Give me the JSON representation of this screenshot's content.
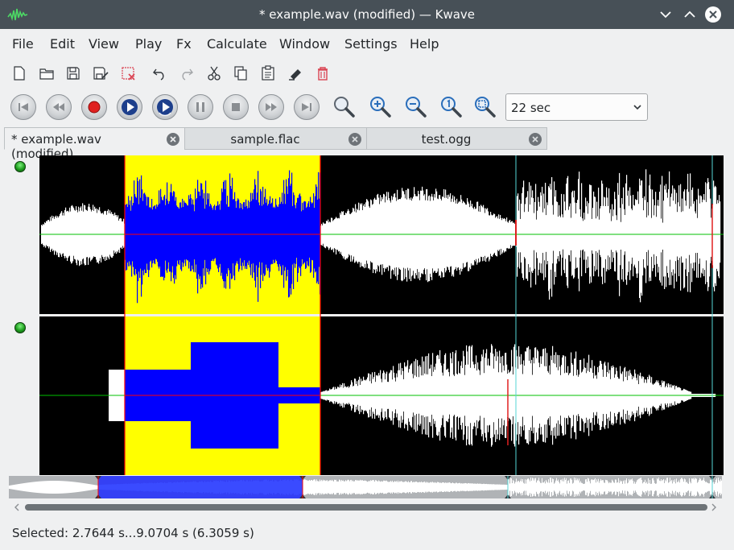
{
  "window": {
    "title": "* example.wav (modified) — Kwave"
  },
  "menu": [
    "File",
    "Edit",
    "View",
    "Play",
    "Fx",
    "Calculate",
    "Window",
    "Settings",
    "Help"
  ],
  "toolbar": {
    "file_icons": [
      "new-file-icon",
      "open-folder-icon",
      "save-icon",
      "save-as-icon",
      "close-file-icon"
    ],
    "edit_icons": [
      "undo-icon",
      "redo-icon",
      "cut-icon",
      "copy-icon",
      "paste-icon",
      "erase-icon",
      "delete-icon"
    ]
  },
  "transport": [
    "rewind-to-start-icon",
    "rewind-icon",
    "record-icon",
    "play-icon",
    "loop-play-icon",
    "pause-icon",
    "stop-icon",
    "forward-icon",
    "forward-to-end-icon"
  ],
  "zoom": {
    "icons": [
      "zoom-selection-icon",
      "zoom-in-icon",
      "zoom-out-icon",
      "zoom-original-icon",
      "zoom-all-icon"
    ],
    "selected": "22 sec"
  },
  "tabs": [
    {
      "label": "* example.wav (modified)",
      "active": true
    },
    {
      "label": "sample.flac",
      "active": false
    },
    {
      "label": "test.ogg",
      "active": false
    }
  ],
  "colors": {
    "selection": "#ffff00",
    "selected_waveform": "#0000ff",
    "waveform": "#ffffff",
    "background": "#000000",
    "zero_line": "#00c000",
    "markers": "#ff0000",
    "labels": "#55d6d6"
  },
  "statusbar": {
    "text": "Selected: 2.7644 s...9.0704 s (6.3059 s)"
  }
}
